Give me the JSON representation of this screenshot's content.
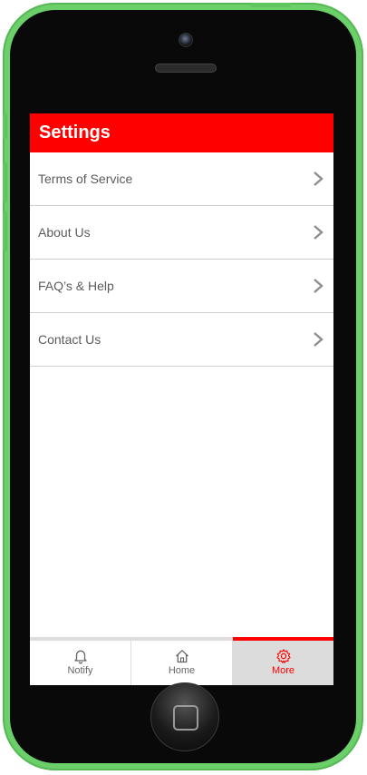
{
  "header": {
    "title": "Settings"
  },
  "settings": {
    "items": [
      {
        "label": "Terms of Service",
        "icon": "chevron-right-icon"
      },
      {
        "label": "About Us",
        "icon": "chevron-right-icon"
      },
      {
        "label": "FAQ’s & Help",
        "icon": "chevron-right-icon"
      },
      {
        "label": "Contact Us",
        "icon": "chevron-right-icon"
      }
    ]
  },
  "tabbar": {
    "active": "More",
    "tabs": [
      {
        "label": "Notify",
        "icon": "bell-icon"
      },
      {
        "label": "Home",
        "icon": "home-icon"
      },
      {
        "label": "More",
        "icon": "gear-icon"
      }
    ]
  },
  "colors": {
    "accent": "#fe0000",
    "phone_shell": "#6bcf6a",
    "bezel": "#090909",
    "active_tab_bg": "#dcdcdc"
  }
}
